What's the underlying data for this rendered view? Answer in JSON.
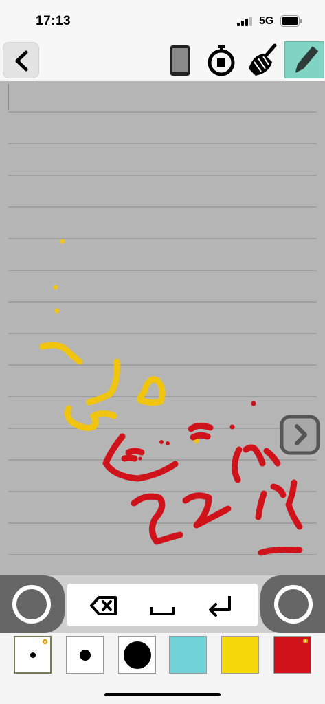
{
  "status_bar": {
    "time": "17:13",
    "network": "5G"
  },
  "toolbar": {
    "icons": [
      "back-chevron-icon",
      "phone-icon",
      "stopwatch-icon",
      "broom-icon",
      "pencil-icon"
    ],
    "active_tool": "pencil",
    "active_color": "#7fd4c4"
  },
  "canvas": {
    "background": "#b5b5b5",
    "line_color": "#8c8c8c",
    "ink_colors": [
      "#f1c40f",
      "#d0121b"
    ]
  },
  "keypad": {
    "icons": [
      "backspace-icon",
      "space-icon",
      "return-icon"
    ]
  },
  "palette": {
    "brush_sizes": [
      "small",
      "medium",
      "large"
    ],
    "selected_brush": "small",
    "colors": [
      "#6fd3d8",
      "#f5d80a",
      "#d0121b"
    ],
    "selected_color": "#d0121b"
  }
}
